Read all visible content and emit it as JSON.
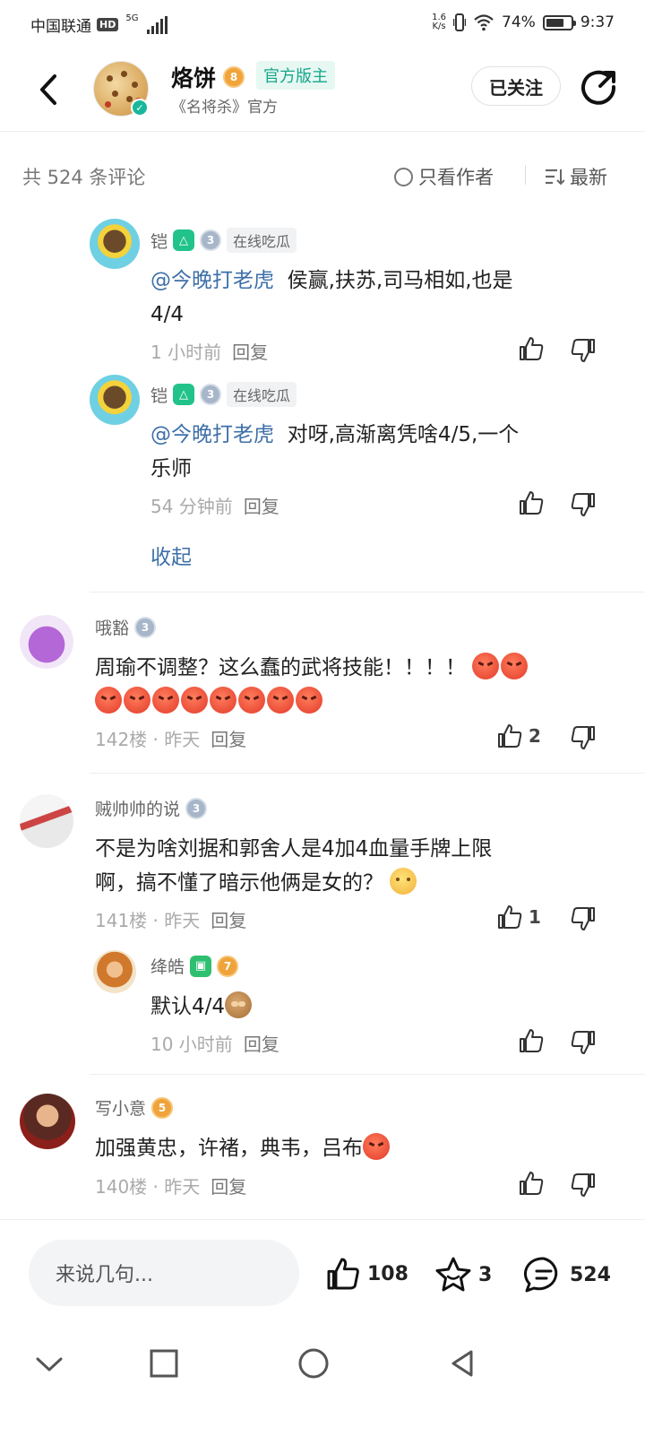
{
  "status_bar": {
    "carrier": "中国联通",
    "hd": "HD",
    "network": "5G",
    "speed_top": "1.6",
    "speed_bottom": "K/s",
    "battery": "74%",
    "battery_level": 0.74,
    "time": "9:37"
  },
  "header": {
    "user_name": "烙饼",
    "level": "8",
    "mod_tag": "官方版主",
    "subtitle": "《名将杀》官方",
    "follow_label": "已关注"
  },
  "comments_bar": {
    "count": "共 524 条评论",
    "author_only": "只看作者",
    "sort": "最新"
  },
  "comments": [
    {
      "name": "铠",
      "level": "3",
      "tag": "在线吃瓜",
      "mention": "@今晚打老虎",
      "text": "侯赢,扶苏,司马相如,也是",
      "text_line2": "4/4",
      "time": "1 小时前",
      "reply": "回复"
    },
    {
      "name": "铠",
      "level": "3",
      "tag": "在线吃瓜",
      "mention": "@今晚打老虎",
      "text": "对呀,高渐离凭啥4/5,一个",
      "text_line2": "乐师",
      "time": "54 分钟前",
      "reply": "回复"
    },
    {
      "collapse": "收起"
    },
    {
      "name": "哦豁",
      "level": "3",
      "text": "周瑜不调整？这么蠢的武将技能！！！！",
      "floor": "142楼",
      "time": "昨天",
      "reply": "回复",
      "likes": "2"
    },
    {
      "name": "贼帅帅的说",
      "level": "3",
      "text": "不是为啥刘据和郭舍人是4加4血量手牌上限",
      "text_line2": "啊，搞不懂了暗示他俩是女的？",
      "floor": "141楼",
      "time": "昨天",
      "reply": "回复",
      "likes": "1"
    },
    {
      "name": "绛皓",
      "level": "7",
      "text": "默认4/4",
      "time": "10 小时前",
      "reply": "回复"
    },
    {
      "name": "写小意",
      "level": "5",
      "text": "加强黄忠，许褚，典韦，吕布",
      "floor": "140楼",
      "time": "昨天",
      "reply": "回复"
    }
  ],
  "bottom_bar": {
    "input_placeholder": "来说几句...",
    "likes": "108",
    "favorites": "3",
    "comments": "524"
  },
  "colors": {
    "accent_green": "#16a78a",
    "mention_blue": "#3d6fa8",
    "level_gold": "#efa33a"
  }
}
